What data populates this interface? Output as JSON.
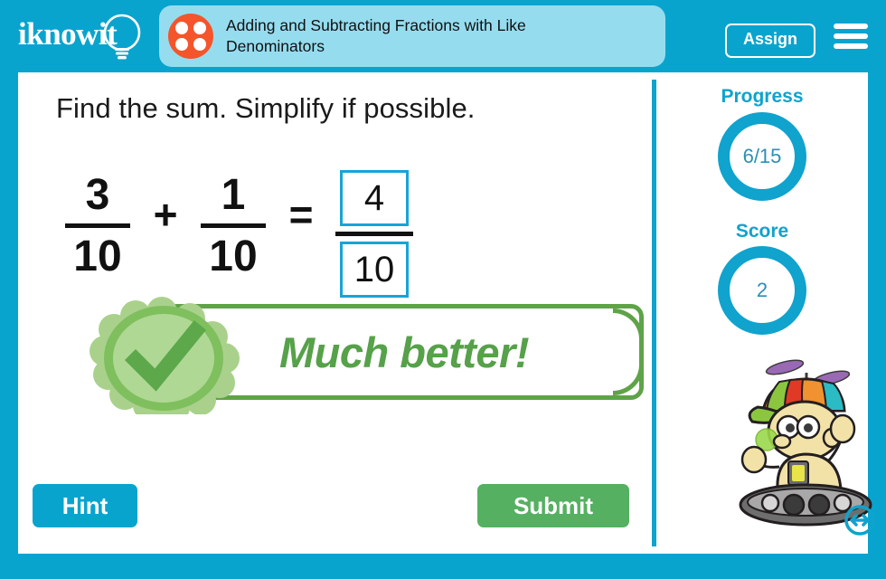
{
  "header": {
    "logo_text": "iknowit",
    "logo_icon": "lightbulb-icon",
    "lesson_icon": "four-dots-circle-icon",
    "lesson_title": "Adding and Subtracting Fractions with Like Denominators",
    "assign_label": "Assign",
    "menu_icon": "hamburger-menu-icon"
  },
  "main": {
    "question": "Find the sum. Simplify if possible.",
    "equation": {
      "first_fraction": {
        "numerator": "3",
        "denominator": "10"
      },
      "operator": "+",
      "second_fraction": {
        "numerator": "1",
        "denominator": "10"
      },
      "equals": "=",
      "answer": {
        "numerator_value": "4",
        "numerator_placeholder": "",
        "denominator": "10"
      }
    },
    "feedback": {
      "icon": "green-check-badge-icon",
      "message": "Much better!"
    },
    "hint_label": "Hint",
    "submit_label": "Submit"
  },
  "sidebar": {
    "progress_label": "Progress",
    "progress_value": "6/15",
    "score_label": "Score",
    "score_value": "2",
    "mascot_icon": "propeller-hat-robot-mascot",
    "resize_icon": "horizontal-resize-icon"
  },
  "colors": {
    "header_blue": "#09A4CE",
    "title_pill_blue": "#96DCEF",
    "accent_orange": "#F4552B",
    "feedback_green": "#56A14A",
    "submit_green": "#55B061",
    "input_border_blue": "#17A4D6"
  }
}
